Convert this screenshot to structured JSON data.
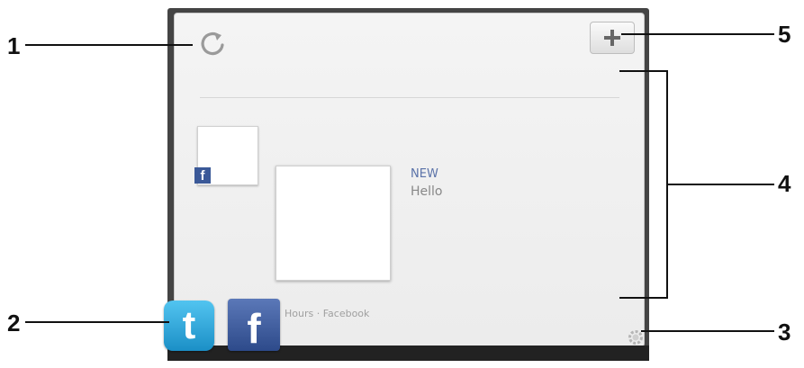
{
  "callouts": [
    {
      "number": "1",
      "target": "refresh-icon"
    },
    {
      "number": "2",
      "target": "app-icons"
    },
    {
      "number": "3",
      "target": "settings-gear-icon"
    },
    {
      "number": "4",
      "target": "feed-area"
    },
    {
      "number": "5",
      "target": "add-button"
    }
  ],
  "widget": {
    "refresh_icon": "refresh-icon",
    "add_button": {
      "icon": "plus-icon",
      "label": "+"
    },
    "settings_icon": "gear-icon"
  },
  "feed": {
    "source_badge": "f",
    "post": {
      "title": "NEW",
      "body": "Hello"
    },
    "meta": "Hours · Facebook"
  },
  "apps": [
    {
      "name": "Twitter",
      "glyph": "t",
      "icon": "twitter-icon",
      "color": "#2aa6de"
    },
    {
      "name": "Facebook",
      "glyph": "f",
      "icon": "facebook-icon",
      "color": "#3b5998"
    }
  ]
}
